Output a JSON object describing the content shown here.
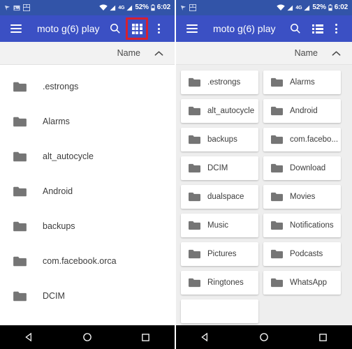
{
  "colors": {
    "statusbar_bg": "#3254a8",
    "toolbar_bg": "#3b50c4",
    "highlight_border": "#d6202f",
    "sortbar_bg": "#f2f2f2",
    "grid_bg": "#eeeeee",
    "card_bg": "#ffffff",
    "folder_icon": "#757575",
    "text": "#3c3c3c",
    "navbar_bg": "#000000"
  },
  "statusbar": {
    "notification_icons": [
      "send-icon",
      "image-icon",
      "screenshot-icon"
    ],
    "wifi_icon": "wifi-icon",
    "signal_icon": "signal-bars-icon",
    "network_type": "4G",
    "signal2_icon": "signal-bars-icon",
    "battery_percent": "52%",
    "battery_icon": "battery-icon",
    "clock": "6:02"
  },
  "left_panel": {
    "toolbar": {
      "menu_icon": "hamburger-menu-icon",
      "title": "moto g(6) play",
      "search_icon": "search-icon",
      "view_toggle_icon": "grid-view-icon",
      "view_toggle_highlighted": true,
      "overflow_icon": "more-options-icon"
    },
    "sortbar": {
      "label": "Name",
      "direction_icon": "chevron-up-icon"
    },
    "view_mode": "list",
    "items": [
      {
        "name": ".estrongs",
        "icon": "folder-icon"
      },
      {
        "name": "Alarms",
        "icon": "folder-icon"
      },
      {
        "name": "alt_autocycle",
        "icon": "folder-icon"
      },
      {
        "name": "Android",
        "icon": "folder-icon"
      },
      {
        "name": "backups",
        "icon": "folder-icon"
      },
      {
        "name": "com.facebook.orca",
        "icon": "folder-icon"
      },
      {
        "name": "DCIM",
        "icon": "folder-icon"
      }
    ],
    "navbar": {
      "back": "back-triangle-icon",
      "home": "home-circle-icon",
      "recents": "recents-square-icon"
    }
  },
  "right_panel": {
    "toolbar": {
      "menu_icon": "hamburger-menu-icon",
      "title": "moto g(6) play",
      "search_icon": "search-icon",
      "view_toggle_icon": "list-view-icon",
      "view_toggle_highlighted": false,
      "overflow_icon": "more-options-icon"
    },
    "sortbar": {
      "label": "Name",
      "direction_icon": "chevron-up-icon"
    },
    "view_mode": "grid",
    "items": [
      {
        "name": ".estrongs",
        "icon": "folder-icon"
      },
      {
        "name": "Alarms",
        "icon": "folder-icon"
      },
      {
        "name": "alt_autocycle",
        "icon": "folder-icon"
      },
      {
        "name": "Android",
        "icon": "folder-icon"
      },
      {
        "name": "backups",
        "icon": "folder-icon"
      },
      {
        "name": "com.facebo...",
        "icon": "folder-icon"
      },
      {
        "name": "DCIM",
        "icon": "folder-icon"
      },
      {
        "name": "Download",
        "icon": "folder-icon"
      },
      {
        "name": "dualspace",
        "icon": "folder-icon"
      },
      {
        "name": "Movies",
        "icon": "folder-icon"
      },
      {
        "name": "Music",
        "icon": "folder-icon"
      },
      {
        "name": "Notifications",
        "icon": "folder-icon"
      },
      {
        "name": "Pictures",
        "icon": "folder-icon"
      },
      {
        "name": "Podcasts",
        "icon": "folder-icon"
      },
      {
        "name": "Ringtones",
        "icon": "folder-icon"
      },
      {
        "name": "WhatsApp",
        "icon": "folder-icon"
      },
      {
        "name": "",
        "icon": ""
      }
    ],
    "navbar": {
      "back": "back-triangle-icon",
      "home": "home-circle-icon",
      "recents": "recents-square-icon"
    }
  }
}
